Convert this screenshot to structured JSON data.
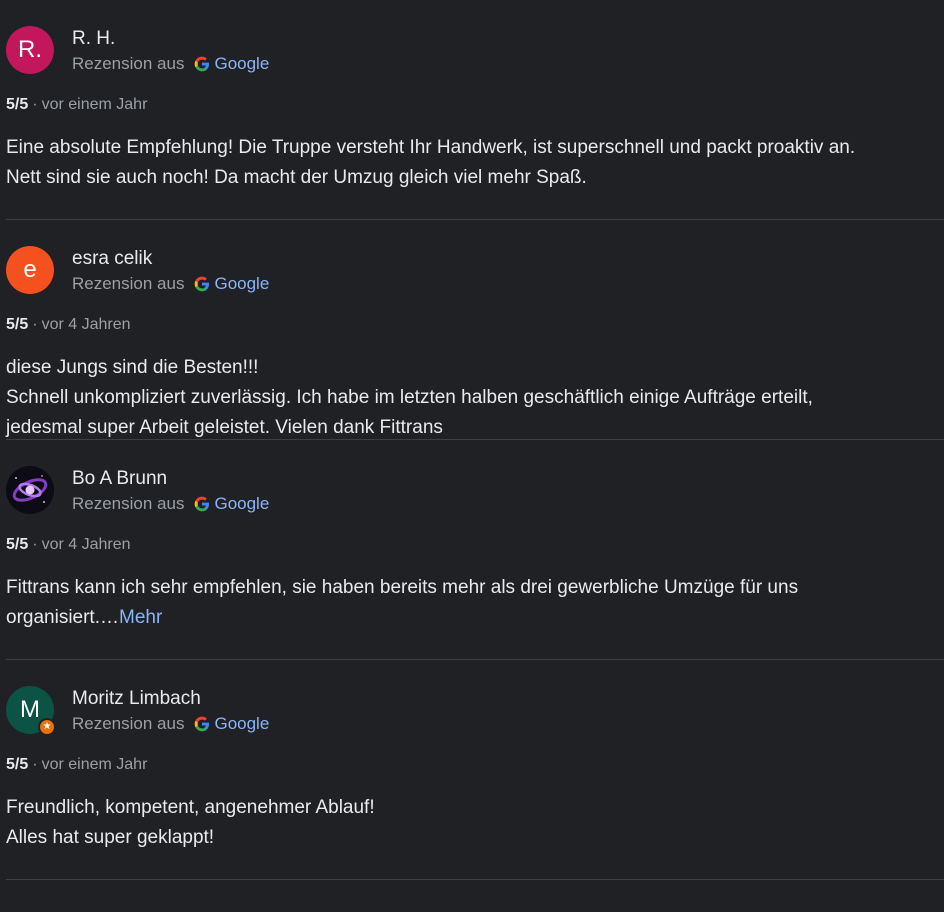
{
  "source_prefix": "Rezension aus",
  "source_name": "Google",
  "colors": {
    "background": "#202124",
    "divider": "#3c4043",
    "link": "#8ab4f8",
    "muted": "#9aa0a6",
    "text": "#e8eaed"
  },
  "reviews": [
    {
      "author": "R. H.",
      "avatar_letter": "R.",
      "avatar_color": "#c2185b",
      "rating": "5/5",
      "date": "vor einem Jahr",
      "lines": [
        "Eine absolute Empfehlung! Die Truppe versteht Ihr Handwerk, ist superschnell und packt proaktiv an.",
        "Nett sind sie auch noch! Da macht der Umzug gleich viel mehr Spaß."
      ]
    },
    {
      "author": "esra celik",
      "avatar_letter": "e",
      "avatar_color": "#f4511e",
      "rating": "5/5",
      "date": "vor 4 Jahren",
      "lines": [
        "diese Jungs sind die Besten!!!",
        "Schnell unkompliziert zuverlässig. Ich habe im letzten halben geschäftlich einige Aufträge erteilt,",
        "jedesmal super Arbeit geleistet. Vielen dank Fittrans"
      ]
    },
    {
      "author": "Bo A Brunn",
      "avatar_icon": "galaxy-photo-icon",
      "rating": "5/5",
      "date": "vor 4 Jahren",
      "lines": [
        "Fittrans kann ich sehr empfehlen, sie haben bereits mehr als drei gewerbliche Umzüge für uns",
        "organisiert.…"
      ],
      "more_label": "Mehr"
    },
    {
      "author": "Moritz Limbach",
      "avatar_letter": "M",
      "avatar_color": "#0b5345",
      "badge_icon": "local-guide-star-icon",
      "rating": "5/5",
      "date": "vor einem Jahr",
      "lines": [
        "Freundlich, kompetent, angenehmer Ablauf!",
        "Alles hat super geklappt!"
      ]
    }
  ]
}
